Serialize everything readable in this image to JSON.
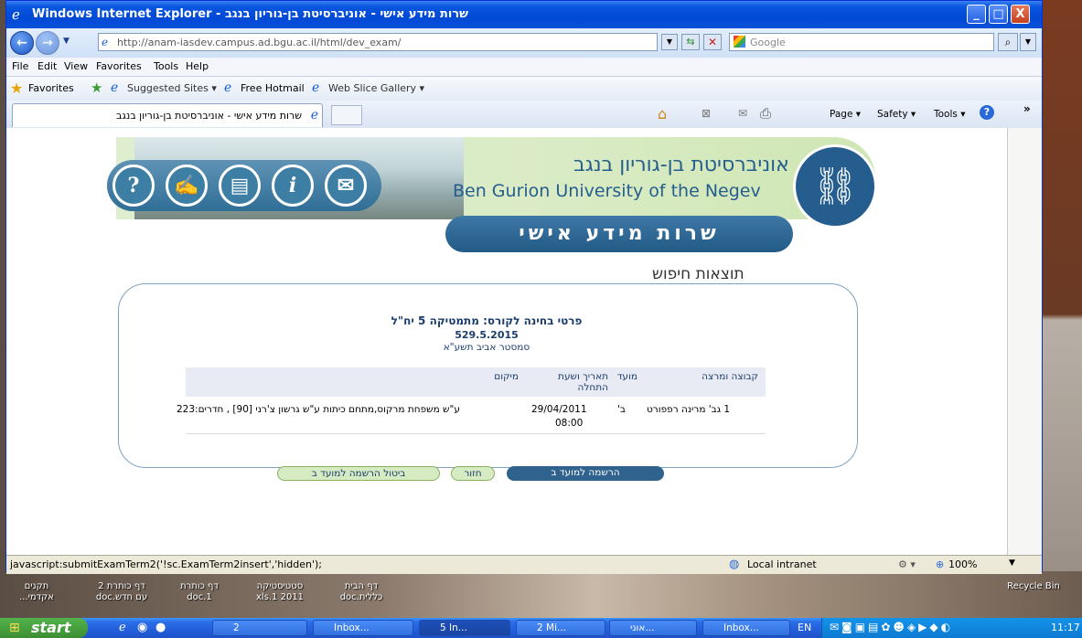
{
  "window": {
    "title": "שרות מידע אישי - אוניברסיטת בן-גוריון בנגב - Windows Internet Explorer",
    "controls": [
      "_",
      "□",
      "X"
    ]
  },
  "address": {
    "url": "http://anam-iasdev.campus.ad.bgu.ac.il/html/dev_exam/",
    "search_placeholder": "Google"
  },
  "menu": [
    "File",
    "Edit",
    "View",
    "Favorites",
    "Tools",
    "Help"
  ],
  "favorites": {
    "favorites_label": "Favorites",
    "suggested": "Suggested Sites ▾",
    "hotmail": "Free Hotmail",
    "webslice": "Web Slice Gallery ▾"
  },
  "tab": {
    "label": "שרות מידע אישי - אוניברסיטת בן-גוריון בנגב"
  },
  "commands": {
    "page": "Page ▾",
    "safety": "Safety ▾",
    "tools": "Tools ▾"
  },
  "banner": {
    "univ_he": "אוניברסיטת בן-גוריון בנגב",
    "univ_en": "Ben Gurion University of the Negev",
    "service": "שרות מידע אישי",
    "icons": [
      "?",
      "✍",
      "▤",
      "i",
      "✉"
    ]
  },
  "results": {
    "section_title": "תוצאות חיפוש",
    "exam_title": "פרטי בחינה לקורס: מתמטיקה 5 יח\"ל",
    "exam_code": "529.5.2015",
    "semester": "סמסטר אביב תשע\"א",
    "headers": {
      "group": "קבוצה ומרצה",
      "term": "מועד",
      "date": "תאריך ושעת התחלה",
      "location": "מיקום"
    },
    "rows": [
      {
        "group": "1 גב' מרינה רפפורט",
        "term": "ב'",
        "date": "29/04/2011",
        "time": "08:00",
        "location": "ע\"ש משפחת מרקוס,מתחם כיתות ע\"ש גרשון צ'רני [90] , חדרים:223"
      }
    ],
    "buttons": {
      "register": "הרשמה למועד ב",
      "back": "חזור",
      "cancel": "ביטול הרשמה למועד ב"
    }
  },
  "status": {
    "text": "javascript:submitExamTerm2('!sc.ExamTerm2insert','hidden');",
    "zone": "Local intranet",
    "zoom": "100%"
  },
  "desktop_icons": [
    "תקנים אקדמי...",
    "דף כותרת 2 עם חדש.doc",
    "דף כותרת 1.doc",
    "סטטיסטיקה 2011 1.xls",
    "דף הבית כללית.doc"
  ],
  "recycle_bin": "Recycle Bin",
  "taskbar": {
    "start": "start",
    "buttons": [
      "2",
      "Inbox...",
      "5 In...",
      "2 Mi...",
      "אוני...",
      "Inbox..."
    ],
    "lang": "EN",
    "clock": "11:17"
  }
}
